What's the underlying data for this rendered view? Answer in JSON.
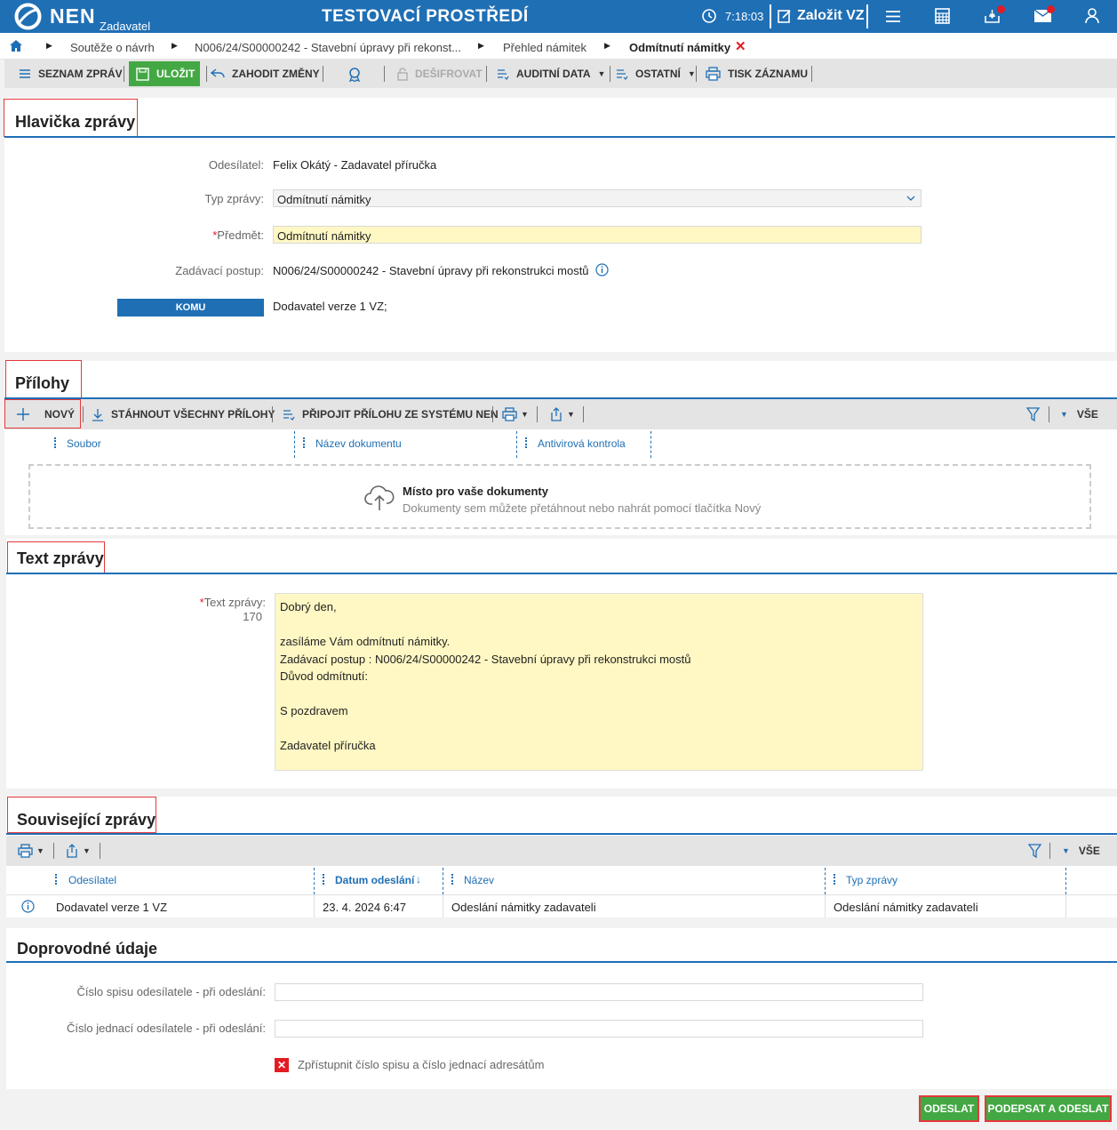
{
  "header": {
    "logo_text": "NEN",
    "logo_sub": "Zadavatel",
    "environment": "TESTOVACÍ PROSTŘEDÍ",
    "time": "7:18:03",
    "create_label": "Založit VZ",
    "icons": [
      "clock-icon",
      "edit-icon",
      "menu-icon",
      "calculator-icon",
      "inbox-icon",
      "mail-icon",
      "user-icon"
    ]
  },
  "breadcrumb": {
    "items": [
      "Soutěže o návrh",
      "N006/24/S00000242 - Stavební úpravy při rekonst...",
      "Přehled námitek",
      "Odmítnutí námitky"
    ]
  },
  "toolbar": {
    "message_list": "SEZNAM ZPRÁV",
    "save": "ULOŽIT",
    "discard": "ZAHODIT ZMĚNY",
    "decrypt": "DEŠIFROVAT",
    "audit": "AUDITNÍ DATA",
    "other": "OSTATNÍ",
    "print": "TISK ZÁZNAMU"
  },
  "header_section": {
    "title": "Hlavička zprávy",
    "sender_label": "Odesílatel:",
    "sender": "Felix Okátý - Zadavatel příručka",
    "type_label": "Typ zprávy:",
    "type_value": "Odmítnutí námitky",
    "subject_label": "Předmět:",
    "subject_value": "Odmítnutí námitky",
    "procedure_label": "Zadávací postup:",
    "procedure_value": "N006/24/S00000242 - Stavební úpravy při rekonstrukci mostů",
    "to_button": "KOMU",
    "to_value": "Dodavatel verze 1 VZ;"
  },
  "attachments": {
    "title": "Přílohy",
    "new": "NOVÝ",
    "download_all": "STÁHNOUT VŠECHNY PŘÍLOHY",
    "attach_from_nen": "PŘIPOJIT PŘÍLOHU ZE SYSTÉMU NEN",
    "all": "VŠE",
    "columns": [
      "Soubor",
      "Název dokumentu",
      "Antivirová kontrola"
    ],
    "drop_title": "Místo pro vaše dokumenty",
    "drop_hint": "Dokumenty sem můžete přetáhnout nebo nahrát pomocí tlačítka Nový"
  },
  "text_section": {
    "title": "Text zprávy",
    "label": "Text zprávy:",
    "count": "170",
    "body": "Dobrý den,\n\nzasíláme Vám odmítnutí námitky.\nZadávací postup : N006/24/S00000242 - Stavební úpravy při rekonstrukci mostů\nDůvod odmítnutí:\n\nS pozdravem\n\nZadavatel příručka"
  },
  "related": {
    "title": "Související zprávy",
    "all": "VŠE",
    "columns": [
      "Odesílatel",
      "Datum odeslání",
      "Název",
      "Typ zprávy"
    ],
    "rows": [
      {
        "sender": "Dodavatel verze 1 VZ",
        "date": "23. 4. 2024 6:47",
        "name": "Odeslání námitky zadavateli",
        "type": "Odeslání námitky zadavateli"
      }
    ]
  },
  "accompanying": {
    "title": "Doprovodné údaje",
    "file_no_label": "Číslo spisu odesílatele - při odeslání:",
    "file_no_value": "",
    "ref_no_label": "Číslo jednací odesílatele - při odeslání:",
    "ref_no_value": "",
    "share_label": "Zpřístupnit číslo spisu a číslo jednací adresátům",
    "share_checked": false
  },
  "footer": {
    "send": "ODESLAT",
    "sign_send": "PODEPSAT A ODESLAT"
  },
  "colors": {
    "primary": "#1f6fb5",
    "green": "#43a843",
    "highlight": "#e5383b",
    "required": "#fff8c4"
  }
}
